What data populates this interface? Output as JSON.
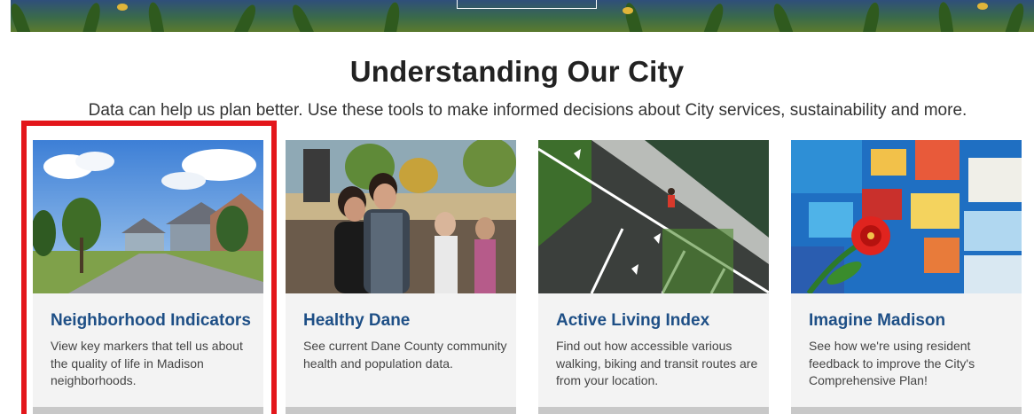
{
  "section": {
    "title": "Understanding Our City",
    "subtitle": "Data can help us plan better. Use these tools to make informed decisions about City services, sustainability and more."
  },
  "cards": [
    {
      "title": "Neighborhood Indicators",
      "description": "View key markers that tell us about the quality of life in Madison neighborhoods.",
      "image": "suburban-street-photo",
      "highlighted": true
    },
    {
      "title": "Healthy Dane",
      "description": "See current Dane County community health and population data.",
      "image": "couple-at-outdoor-event-photo",
      "highlighted": false
    },
    {
      "title": "Active Living Index",
      "description": "Find out how accessible various walking, biking and transit routes are from your location.",
      "image": "aerial-runner-path-photo",
      "highlighted": false
    },
    {
      "title": "Imagine Madison",
      "description": "See how we're using resident feedback to improve the City's Comprehensive Plan!",
      "image": "mosaic-flower-photo",
      "highlighted": false
    }
  ],
  "colors": {
    "card_title": "#1e4f86",
    "card_background": "#f3f3f3",
    "highlight": "#e3161b"
  }
}
